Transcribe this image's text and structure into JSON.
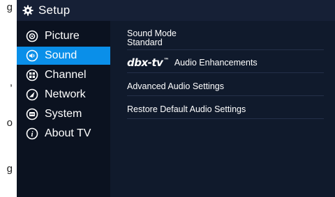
{
  "background_fragments": [
    "g",
    ",",
    "o",
    "g"
  ],
  "header": {
    "title": "Setup",
    "icon": "gear-icon"
  },
  "sidebar": {
    "items": [
      {
        "label": "Picture",
        "icon": "picture-icon",
        "selected": false
      },
      {
        "label": "Sound",
        "icon": "speaker-icon",
        "selected": true
      },
      {
        "label": "Channel",
        "icon": "channel-icon",
        "selected": false
      },
      {
        "label": "Network",
        "icon": "network-icon",
        "selected": false
      },
      {
        "label": "System",
        "icon": "system-icon",
        "selected": false
      },
      {
        "label": "About TV",
        "icon": "info-icon",
        "selected": false
      }
    ]
  },
  "content": {
    "sound_mode_label": "Sound Mode",
    "sound_mode_value": "Standard",
    "dbx_logo": "dbx",
    "dbx_logo_sep": "-",
    "dbx_logo_tv": "tv",
    "dbx_label": "Audio Enhancements",
    "advanced_label": "Advanced Audio Settings",
    "restore_label": "Restore Default Audio Settings"
  },
  "colors": {
    "accent": "#0a8fe9",
    "panel": "#0e1524",
    "header": "#162036",
    "sidebar": "#0b1220"
  }
}
